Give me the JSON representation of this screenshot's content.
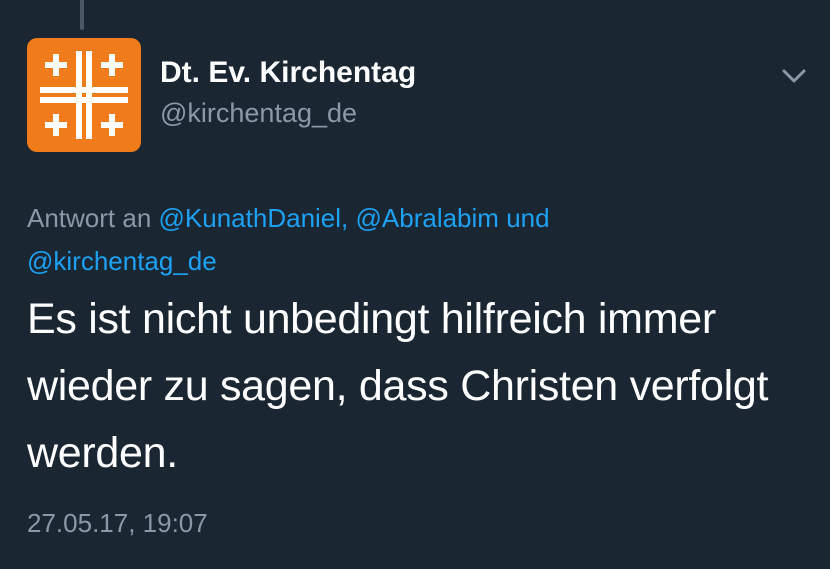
{
  "author": {
    "display_name": "Dt. Ev. Kirchentag",
    "handle": "@kirchentag_de",
    "avatar_icon": "kirchentag-cross-logo-icon",
    "avatar_color": "#f07b1b"
  },
  "reply": {
    "prefix": "Antwort an",
    "mention_1": "@KunathDaniel,",
    "mention_2": "@Abralabim",
    "conjunction": "und",
    "mention_3": "@kirchentag_de"
  },
  "tweet": {
    "lines": [
      "Es ist nicht unbedingt hilfreich immer",
      "wieder zu sagen, dass Christen verfolgt",
      "werden."
    ],
    "timestamp": "27.05.17, 19:07"
  },
  "menu": {
    "icon": "chevron-down-icon"
  },
  "colors": {
    "background": "#1b2633",
    "text": "#ffffff",
    "secondary": "#8b98a6",
    "link": "#1da1f2"
  }
}
